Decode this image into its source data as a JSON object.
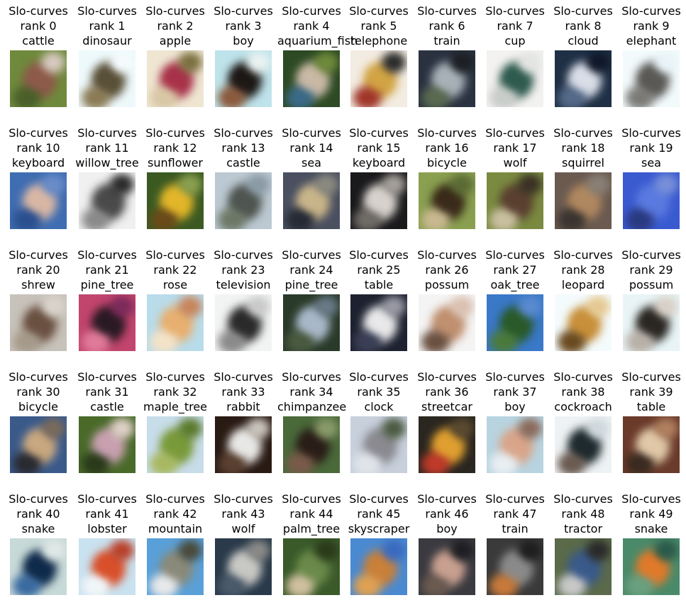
{
  "prefix": "Slo-curves",
  "items": [
    {
      "rank": "rank 0",
      "label": "cattle",
      "colors": [
        "#6f8a3c",
        "#8e5a4a",
        "#4a5f2a",
        "#d7c9c0"
      ]
    },
    {
      "rank": "rank 1",
      "label": "dinosaur",
      "colors": [
        "#eef9fb",
        "#5a5038",
        "#8a7a55",
        "#f4fbfc"
      ]
    },
    {
      "rank": "rank 2",
      "label": "apple",
      "colors": [
        "#efe6d2",
        "#a8324a",
        "#d8c7a5",
        "#7b7040"
      ]
    },
    {
      "rank": "rank 3",
      "label": "boy",
      "colors": [
        "#bfe3ea",
        "#1d1816",
        "#8b5a3c",
        "#e9f2f1"
      ]
    },
    {
      "rank": "rank 4",
      "label": "aquarium_fish",
      "colors": [
        "#2d4a24",
        "#c9b9a6",
        "#3a6a88",
        "#6f8a3a"
      ]
    },
    {
      "rank": "rank 5",
      "label": "telephone",
      "colors": [
        "#f3ece2",
        "#d2a444",
        "#a0362a",
        "#2a2a2a"
      ]
    },
    {
      "rank": "rank 6",
      "label": "train",
      "colors": [
        "#2a3240",
        "#a7b1b8",
        "#5a6a50",
        "#1c1f24"
      ]
    },
    {
      "rank": "rank 7",
      "label": "cup",
      "colors": [
        "#f3f2f0",
        "#2f5a4e",
        "#c8ccc8",
        "#e2e4e2"
      ]
    },
    {
      "rank": "rank 8",
      "label": "cloud",
      "colors": [
        "#1f2f45",
        "#d9dee8",
        "#546a88",
        "#0f1828"
      ]
    },
    {
      "rank": "rank 9",
      "label": "elephant",
      "colors": [
        "#f2fafc",
        "#5a5956",
        "#7b7a76",
        "#e9f4f7"
      ]
    },
    {
      "rank": "rank 10",
      "label": "keyboard",
      "colors": [
        "#3f6db2",
        "#d9b7a5",
        "#2a4f8e",
        "#6a8cc8"
      ]
    },
    {
      "rank": "rank 11",
      "label": "willow_tree",
      "colors": [
        "#f0f0f0",
        "#4a4a4a",
        "#8a8a8a",
        "#2a2a2a"
      ]
    },
    {
      "rank": "rank 12",
      "label": "sunflower",
      "colors": [
        "#3b5a22",
        "#e3b62a",
        "#6a4a1a",
        "#8aa050"
      ]
    },
    {
      "rank": "rank 13",
      "label": "castle",
      "colors": [
        "#bcc9d2",
        "#4f5550",
        "#6d7866",
        "#8a9aa5"
      ]
    },
    {
      "rank": "rank 14",
      "label": "sea",
      "colors": [
        "#4a5060",
        "#c9b58a",
        "#252a35",
        "#8a8a80"
      ]
    },
    {
      "rank": "rank 15",
      "label": "keyboard",
      "colors": [
        "#1a1a1c",
        "#d7d2cc",
        "#6f6b66",
        "#a5a09a"
      ]
    },
    {
      "rank": "rank 16",
      "label": "bicycle",
      "colors": [
        "#8aa050",
        "#3a2a1a",
        "#c9b890",
        "#5a6a35"
      ]
    },
    {
      "rank": "rank 17",
      "label": "wolf",
      "colors": [
        "#7a8a40",
        "#5a4030",
        "#c9c0a0",
        "#3a3025"
      ]
    },
    {
      "rank": "rank 18",
      "label": "squirrel",
      "colors": [
        "#6a5a50",
        "#b08860",
        "#3a3530",
        "#8a8075"
      ]
    },
    {
      "rank": "rank 19",
      "label": "sea",
      "colors": [
        "#3a5ad0",
        "#5a7ae0",
        "#2a3a80",
        "#7890d8"
      ]
    },
    {
      "rank": "rank 20",
      "label": "shrew",
      "colors": [
        "#c7c2ba",
        "#6a5040",
        "#a59a8a",
        "#d9d4cc"
      ]
    },
    {
      "rank": "rank 21",
      "label": "pine_tree",
      "colors": [
        "#c2456e",
        "#2a1a24",
        "#e07a9a",
        "#7a2a5a"
      ]
    },
    {
      "rank": "rank 22",
      "label": "rose",
      "colors": [
        "#b9dcea",
        "#e8b070",
        "#f4e2c8",
        "#c8845a"
      ]
    },
    {
      "rank": "rank 23",
      "label": "television",
      "colors": [
        "#f2f4f3",
        "#2a2a2a",
        "#8a8a8a",
        "#c9c9c9"
      ]
    },
    {
      "rank": "rank 24",
      "label": "pine_tree",
      "colors": [
        "#2a3a2a",
        "#a9b8c8",
        "#4a5a40",
        "#6a7a88"
      ]
    },
    {
      "rank": "rank 25",
      "label": "table",
      "colors": [
        "#1e2230",
        "#e9e9ea",
        "#3a3f55",
        "#9a9aa5"
      ]
    },
    {
      "rank": "rank 26",
      "label": "possum",
      "colors": [
        "#f4f4f4",
        "#c09070",
        "#6a5040",
        "#d9c0b0"
      ]
    },
    {
      "rank": "rank 27",
      "label": "oak_tree",
      "colors": [
        "#3a78c8",
        "#2a5a2a",
        "#4a7a3a",
        "#5a8ad0"
      ]
    },
    {
      "rank": "rank 28",
      "label": "leopard",
      "colors": [
        "#f4fbfc",
        "#c8903a",
        "#6a4a20",
        "#e5c890"
      ]
    },
    {
      "rank": "rank 29",
      "label": "possum",
      "colors": [
        "#e8f4f6",
        "#2a2622",
        "#b8b0a8",
        "#d8d0c6"
      ]
    },
    {
      "rank": "rank 30",
      "label": "bicycle",
      "colors": [
        "#3a5a8a",
        "#c9a880",
        "#2a2a30",
        "#7a6a5a"
      ]
    },
    {
      "rank": "rank 31",
      "label": "castle",
      "colors": [
        "#4a6a2a",
        "#c8a0b0",
        "#2a3a1a",
        "#e0d0c8"
      ]
    },
    {
      "rank": "rank 32",
      "label": "maple_tree",
      "colors": [
        "#c8ddea",
        "#7a9a3a",
        "#a8b860",
        "#5a7a2a"
      ]
    },
    {
      "rank": "rank 33",
      "label": "rabbit",
      "colors": [
        "#2a1a14",
        "#e8e8e6",
        "#5a4030",
        "#c9c4bc"
      ]
    },
    {
      "rank": "rank 34",
      "label": "chimpanzee",
      "colors": [
        "#4a6a3a",
        "#2a1e18",
        "#7a5a4a",
        "#8a9a6a"
      ]
    },
    {
      "rank": "rank 35",
      "label": "clock",
      "colors": [
        "#c8d0dc",
        "#8a8a90",
        "#e0e4ea",
        "#4a5a40"
      ]
    },
    {
      "rank": "rank 36",
      "label": "streetcar",
      "colors": [
        "#2a2620",
        "#e0a030",
        "#c03a2a",
        "#5a4a30"
      ]
    },
    {
      "rank": "rank 37",
      "label": "boy",
      "colors": [
        "#b8d4e0",
        "#d9a58a",
        "#e8eef2",
        "#8a6a5a"
      ]
    },
    {
      "rank": "rank 38",
      "label": "cockroach",
      "colors": [
        "#eef2f4",
        "#1e2a2e",
        "#6a5a50",
        "#d0d8dc"
      ]
    },
    {
      "rank": "rank 39",
      "label": "table",
      "colors": [
        "#6a3a2a",
        "#e0c8a8",
        "#3a2a20",
        "#b08060"
      ]
    },
    {
      "rank": "rank 40",
      "label": "snake",
      "colors": [
        "#c8dad8",
        "#0f2a4a",
        "#3a6aa0",
        "#e0e8e6"
      ]
    },
    {
      "rank": "rank 41",
      "label": "lobster",
      "colors": [
        "#c9e2f0",
        "#d8502a",
        "#f0f6f8",
        "#b8402a"
      ]
    },
    {
      "rank": "rank 42",
      "label": "mountain",
      "colors": [
        "#5aa0d8",
        "#8a8a7a",
        "#e8e8e8",
        "#4a4a3a"
      ]
    },
    {
      "rank": "rank 43",
      "label": "wolf",
      "colors": [
        "#2a3a4a",
        "#c8c8c4",
        "#4a5a6a",
        "#8a8a88"
      ]
    },
    {
      "rank": "rank 44",
      "label": "palm_tree",
      "colors": [
        "#3a5a2a",
        "#6a8a4a",
        "#d0c0a0",
        "#2a3a1a"
      ]
    },
    {
      "rank": "rank 45",
      "label": "skyscraper",
      "colors": [
        "#4a8ad0",
        "#c8803a",
        "#e0a050",
        "#3a6ac0"
      ]
    },
    {
      "rank": "rank 46",
      "label": "boy",
      "colors": [
        "#3a3a40",
        "#c8a090",
        "#6a5a50",
        "#1e1e22"
      ]
    },
    {
      "rank": "rank 47",
      "label": "train",
      "colors": [
        "#3a3a3a",
        "#8a8a8a",
        "#c87a3a",
        "#1e1e1e"
      ]
    },
    {
      "rank": "rank 48",
      "label": "tractor",
      "colors": [
        "#5a6a4a",
        "#3a5a8a",
        "#c8c8c8",
        "#2a2a2a"
      ]
    },
    {
      "rank": "rank 49",
      "label": "snake",
      "colors": [
        "#4a8a6a",
        "#e07a2a",
        "#6aa080",
        "#2a5a4a"
      ]
    }
  ]
}
